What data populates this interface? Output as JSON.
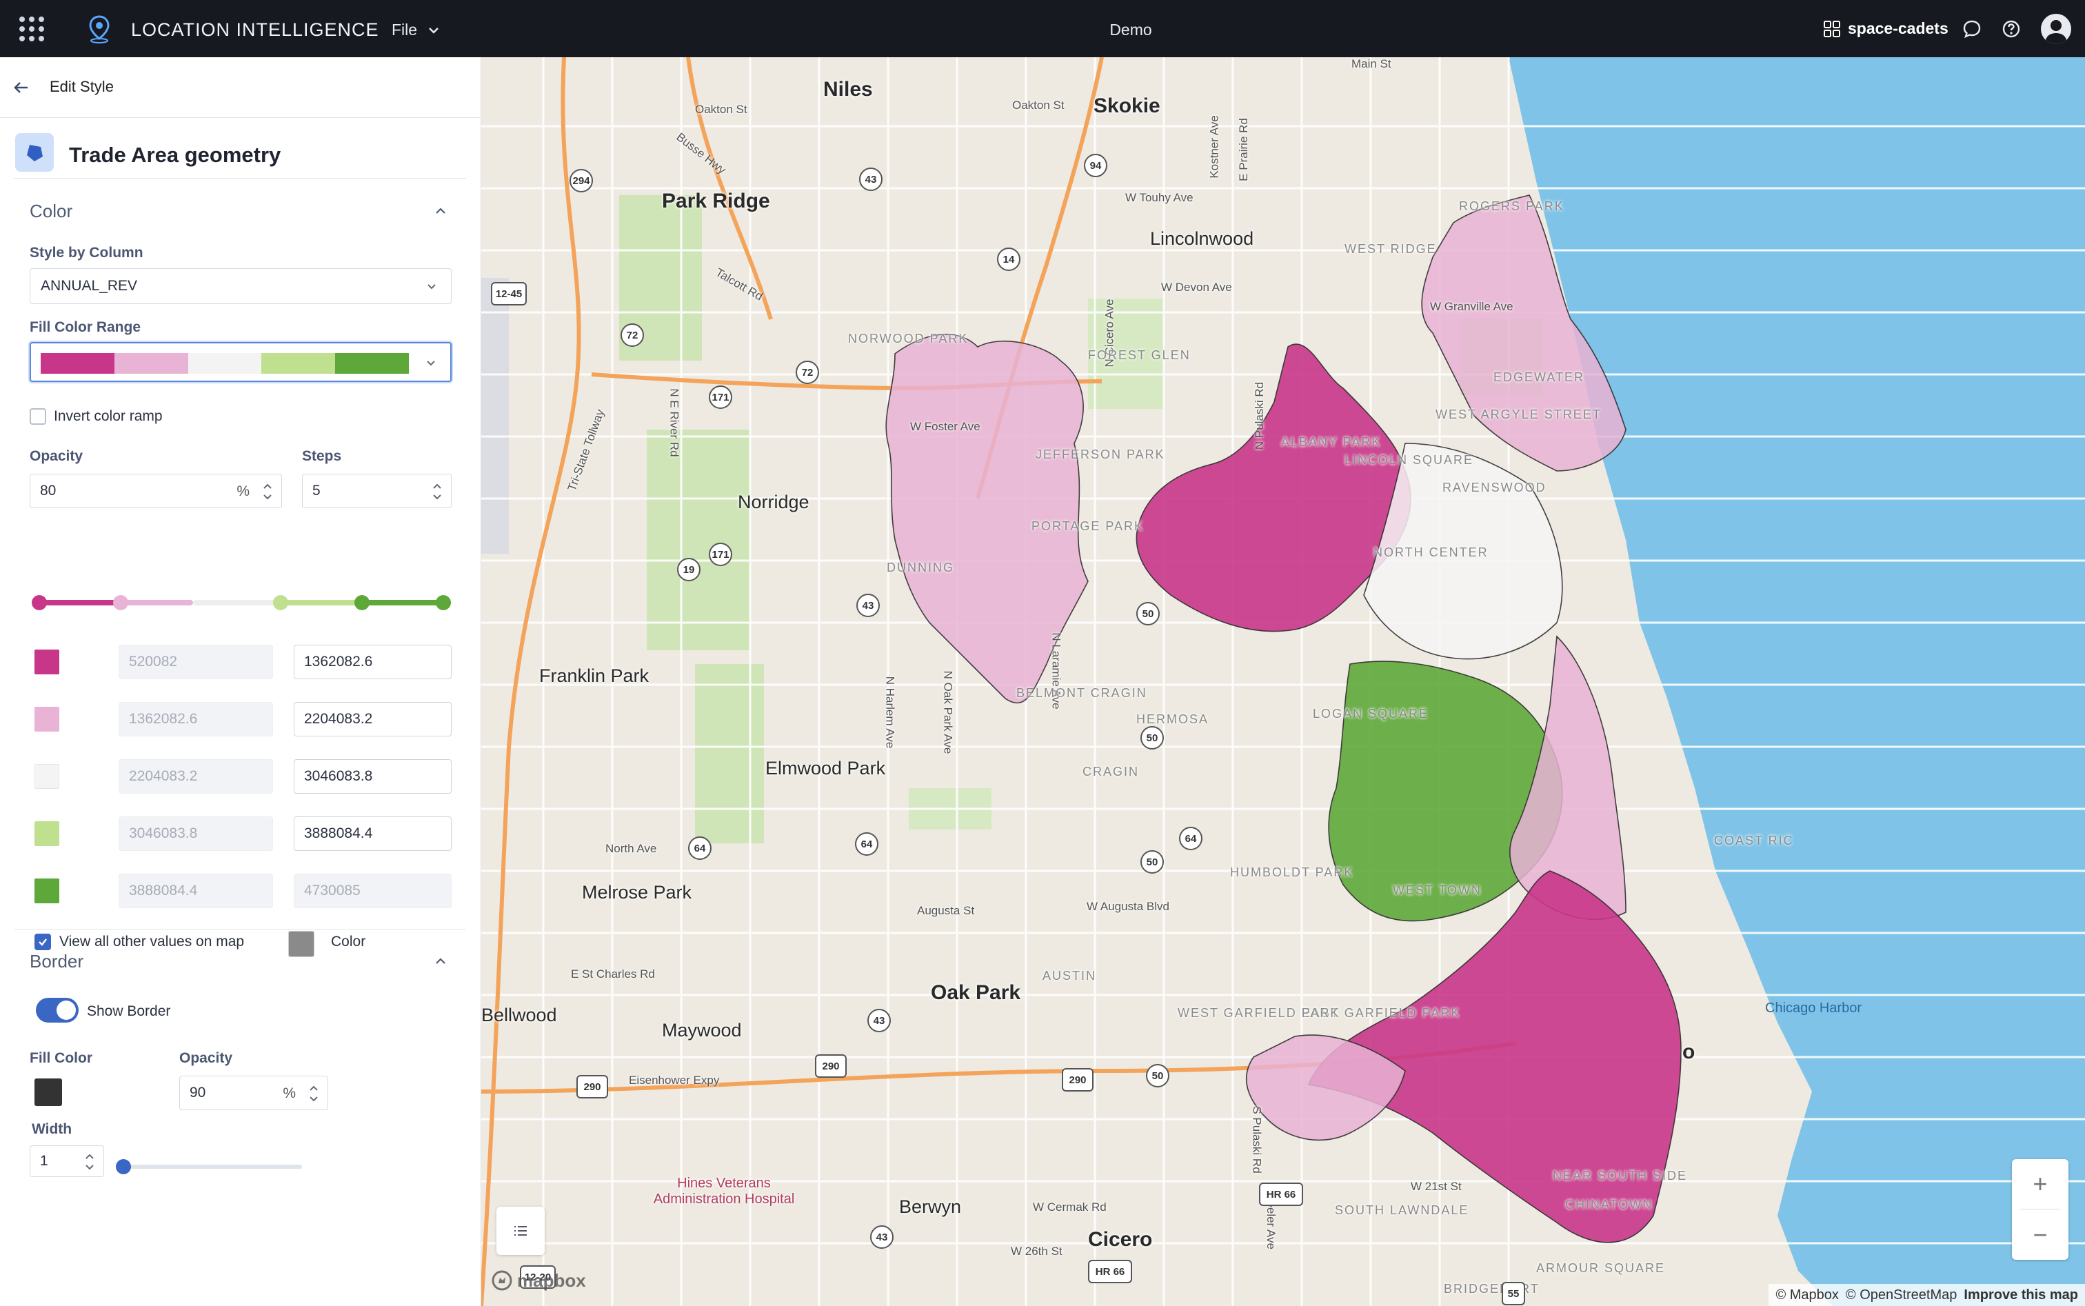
{
  "app": {
    "brand": "LOCATION INTELLIGENCE",
    "file_menu": "File",
    "document_title": "Demo",
    "org_name": "space-cadets"
  },
  "sidebar": {
    "header_title": "Edit Style",
    "layer_title": "Trade Area geometry",
    "color_section": {
      "title": "Color",
      "style_by_column_label": "Style by Column",
      "style_by_column_value": "ANNUAL_REV",
      "fill_color_range_label": "Fill Color Range",
      "ramp_colors": [
        "#c8368a",
        "#e8b3d4",
        "#f3f3f3",
        "#bfe08f",
        "#5ea83a"
      ],
      "invert_label": "Invert color ramp",
      "invert_checked": false,
      "opacity_label": "Opacity",
      "opacity_value": "80",
      "opacity_unit": "%",
      "steps_label": "Steps",
      "steps_value": "5",
      "breaks": [
        {
          "color": "#c8368a",
          "from": "520082",
          "to": "1362082.6"
        },
        {
          "color": "#e8b3d4",
          "from": "1362082.6",
          "to": "2204083.2"
        },
        {
          "color": "#f4f4f4",
          "from": "2204083.2",
          "to": "3046083.8"
        },
        {
          "color": "#bfe08f",
          "from": "3046083.8",
          "to": "3888084.4"
        },
        {
          "color": "#5ea83a",
          "from": "3888084.4",
          "to": "4730085"
        }
      ],
      "view_all_label": "View all other values on map",
      "view_all_checked": true,
      "other_color_label": "Color",
      "other_color": "#8a8a8a"
    },
    "border_section": {
      "title": "Border",
      "show_border_label": "Show Border",
      "show_border": true,
      "fill_color_label": "Fill Color",
      "fill_color": "#333333",
      "opacity_label": "Opacity",
      "opacity_value": "90",
      "opacity_unit": "%",
      "width_label": "Width",
      "width_value": "1",
      "width_slider_fraction": 0.0
    }
  },
  "map": {
    "places": [
      "Niles",
      "Skokie",
      "Park Ridge",
      "Lincolnwood",
      "Norridge",
      "Franklin Park",
      "Elmwood Park",
      "Melrose Park",
      "Oak Park",
      "Maywood",
      "Bellwood",
      "Berwyn",
      "Cicero"
    ],
    "streets": [
      "Main St",
      "Oakton St",
      "Busse Hwy",
      "W Touhy Ave",
      "Talcott Rd",
      "W Devon Ave",
      "N Cicero Ave",
      "Kostner Ave",
      "E Prairie Rd",
      "N Pulaski Rd",
      "N E River Rd",
      "Tri-State Tollway",
      "W Foster Ave",
      "N Harlem Ave",
      "N Oak Park Ave",
      "N Laramie Ave",
      "North Ave",
      "Augusta St",
      "W Augusta Blvd",
      "E St Charles Rd",
      "Eisenhower Expy",
      "W Cermak Rd",
      "W 26th St",
      "W 21st St",
      "S Pulaski Rd",
      "S Keeler Ave",
      "W Granville Ave"
    ],
    "neighborhoods": [
      "ROGERS PARK",
      "WEST RIDGE",
      "NORWOOD PARK",
      "FOREST GLEN",
      "JEFFERSON PARK",
      "ALBANY PARK",
      "PORTAGE PARK",
      "DUNNING",
      "BELMONT CRAGIN",
      "HERMOSA",
      "LOGAN SQUARE",
      "CRAGIN",
      "HUMBOLDT PARK",
      "AUSTIN",
      "EAST GARFIELD PARK",
      "WEST GARFIELD PARK",
      "SOUTH LAWNDALE",
      "CHINATOWN",
      "ARMOUR SQUARE",
      "BRIDGEPORT",
      "EDGEWATER",
      "WEST ARGYLE STREET",
      "RAVENSWOOD",
      "NORTH CENTER",
      "LINCOLN SQUARE",
      "WEST TOWN",
      "NEAR SOUTH SIDE",
      "COAST RIC"
    ],
    "hospital": "Hines Veterans Administration Hospital",
    "water_label": "Chicago Harbor",
    "partial_label": "o",
    "shields": [
      "294",
      "94",
      "43",
      "14",
      "72",
      "12-45",
      "171",
      "19",
      "50",
      "64",
      "290",
      "HR 66",
      "55",
      "12-20"
    ],
    "attribution_mapbox": "© Mapbox",
    "attribution_osm": "© OpenStreetMap",
    "attribution_improve": "Improve this map",
    "logo_text": "mapbox",
    "zoom_in": "+",
    "zoom_out": "−"
  }
}
